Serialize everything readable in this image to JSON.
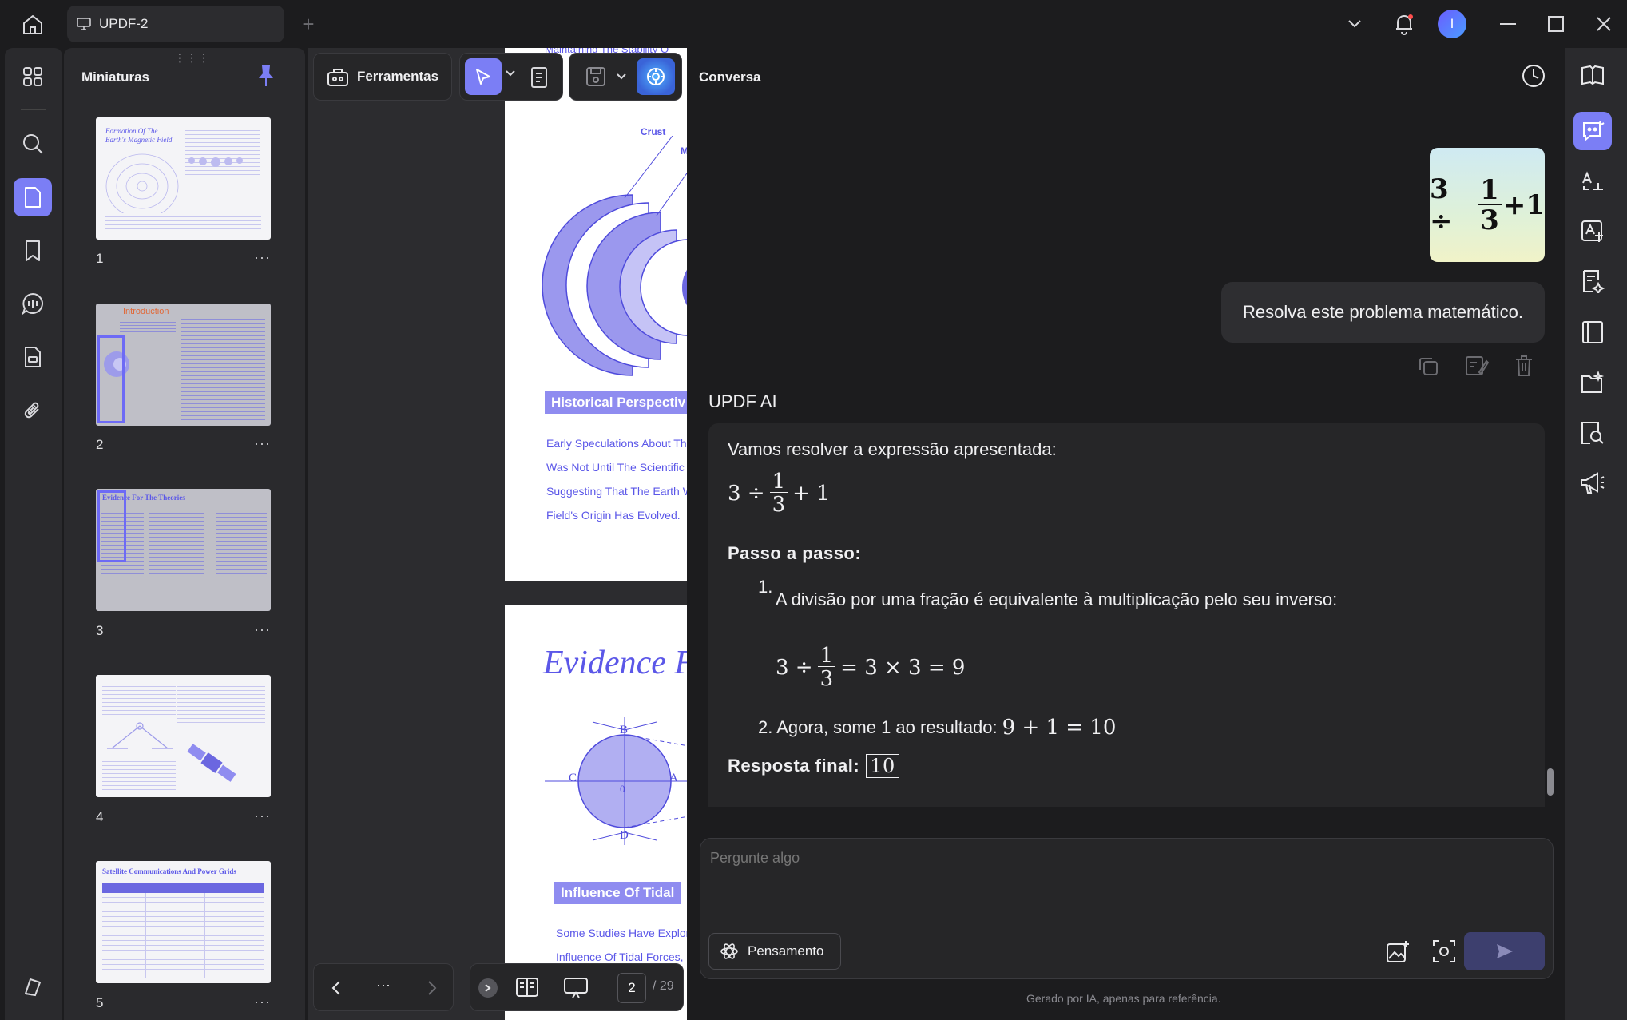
{
  "window": {
    "tab_title": "UPDF-2",
    "avatar_letter": "I"
  },
  "thumbnails": {
    "title": "Miniaturas",
    "drag_handle": "⋮⋮⋮",
    "pages": [
      {
        "number": "1",
        "heading": "Formation Of The Earth's Magnetic Field"
      },
      {
        "number": "2",
        "heading": "Introduction"
      },
      {
        "number": "3",
        "heading": "Evidence For The Theories"
      },
      {
        "number": "4",
        "heading": ""
      },
      {
        "number": "5",
        "heading": "Satellite Communications And Power Grids"
      }
    ],
    "more": "···"
  },
  "toolbar": {
    "tools_label": "Ferramentas"
  },
  "document": {
    "page2": {
      "top_cut": "Maintaining The Stability O",
      "crust": "Crust",
      "mantle_cut": "M",
      "banner": "Historical Perspectiv",
      "lines": [
        "Early Speculations About Th",
        "Was Not Until The Scientific",
        "Suggesting That The Earth W",
        "Field's Origin Has Evolved."
      ]
    },
    "page3": {
      "title": "Evidence F",
      "banner": "Influence Of Tidal",
      "lines": [
        "Some Studies Have Explor",
        "Influence Of Tidal Forces,"
      ],
      "diagram_labels": {
        "b": "B",
        "c": "C",
        "d": "D",
        "a": "A",
        "zero": "0"
      }
    }
  },
  "pager": {
    "current": "2",
    "total": "/ 29",
    "more": "···"
  },
  "chat": {
    "title": "Conversa",
    "image_expr": {
      "lhs": "3 ÷",
      "num": "1",
      "den": "3",
      "rhs": "+1"
    },
    "user_message": "Resolva este problema matemático.",
    "ai_name": "UPDF AI",
    "answer": {
      "intro": "Vamos resolver a expressão apresentada:",
      "expr": {
        "lhs": "3 ÷",
        "num": "1",
        "den": "3",
        "rhs": "+ 1"
      },
      "steps_title": "Passo a passo:",
      "step1_num": "1.",
      "step1_text": "A divisão por uma fração é equivalente à multiplicação pelo seu inverso:",
      "step1_math": {
        "lhs": "3 ÷",
        "num": "1",
        "den": "3",
        "rhs": "= 3 × 3 = 9"
      },
      "step2_text": "2. Agora, some 1 ao resultado:",
      "step2_math": "9 + 1 = 10",
      "final_label": "Resposta final:",
      "final_value": "10"
    },
    "input_placeholder": "Pergunte algo",
    "thinking_label": "Pensamento",
    "disclaimer": "Gerado por IA, apenas para referência."
  },
  "colors": {
    "accent": "#7b7ef5",
    "doc_blue": "#5b57e8",
    "bg": "#1c1c1e",
    "panel": "#2a2a2d"
  }
}
